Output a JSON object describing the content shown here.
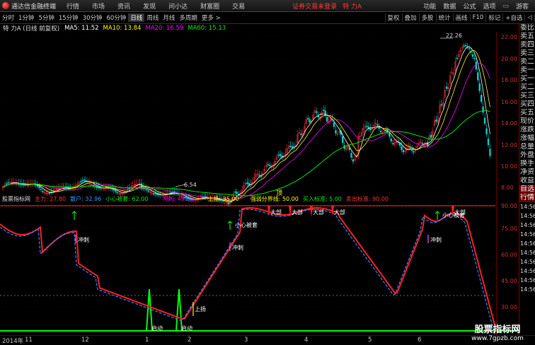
{
  "menubar": {
    "app_title": "通达信金融终端",
    "items": [
      "行情",
      "市场",
      "资讯",
      "发现",
      "问小达",
      "财富圈",
      "交易"
    ],
    "alert": "证券交易未登录",
    "stock_name": "特 力A",
    "right_items": [
      "功能",
      "数据",
      "公式",
      "选项"
    ],
    "user": "游客"
  },
  "tabs": [
    "分时",
    "1分钟",
    "5分钟",
    "15分钟",
    "30分钟",
    "60分钟",
    "日线",
    "周线",
    "月线",
    "多周期",
    "更多 >"
  ],
  "active_tab": "日线",
  "tools": [
    "复权",
    "叠加",
    "多股",
    "统计",
    "画线",
    "F10",
    "标记",
    "+自选",
    "◁"
  ],
  "info": {
    "stock": "特 力A (日线 前复权)",
    "ma5": "MA5: 11.52",
    "ma10": "MA10: 13.84",
    "ma20": "MA20: 16.59",
    "ma60": "MA60: 15.13",
    "colors": {
      "ma5": "#ffffff",
      "ma10": "#ffff00",
      "ma20": "#ff00ff",
      "ma60": "#00e600"
    }
  },
  "price_axis": [
    "22.00",
    "20.00",
    "18.00",
    "16.00",
    "14.00",
    "12.00",
    "10.00",
    "8.00"
  ],
  "annotations": {
    "high": "22.26",
    "low": "6.54",
    "ding": "顶"
  },
  "ind_header": {
    "name": "股票指标网",
    "zhuli": "主力: 27.80",
    "sanhu": "散户: 32.96",
    "xiaoxin": "小心被套: 62.00",
    "chonghe": "冲刺: 49.00",
    "shangyang": "上扬: 35.00",
    "qiangruo": "强弱分界线: 50.00",
    "mairu": "买入标准: 5.00",
    "maichu": "卖出标准: 90.00"
  },
  "ind_axis": [
    "90.00",
    "75.00",
    "60.00",
    "45.00",
    "30.00"
  ],
  "ind_marks": {
    "dibu": "大部",
    "chonghe": "冲刺",
    "xiaoxin": "小心被套",
    "shangyang": "上扬",
    "qidong": "启动"
  },
  "side_items": [
    "委比",
    "卖五",
    "卖四",
    "卖三",
    "卖二",
    "卖一",
    "买一",
    "买二",
    "买三",
    "买四",
    "买五",
    "现价",
    "涨跌",
    "涨幅",
    "总量",
    "外盘",
    "换手",
    "净资",
    "收益",
    "自选",
    "行情"
  ],
  "side_time": [
    "14:56",
    "14:56",
    "14:56",
    "14:56",
    "14:56",
    "14:56",
    "14:56",
    "14:56",
    "14:56",
    "14:56"
  ],
  "date_axis": [
    "2014年",
    "11",
    "12",
    "1",
    "2",
    "3",
    "4",
    "5",
    "6"
  ],
  "watermark": {
    "line1": "股票指标网",
    "line2": "www.7gpzb.com"
  }
}
